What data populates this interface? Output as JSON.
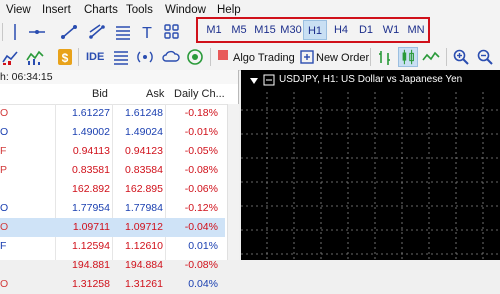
{
  "menubar": {
    "items": [
      {
        "label": "View"
      },
      {
        "label": "Insert"
      },
      {
        "label": "Charts"
      },
      {
        "label": "Tools"
      },
      {
        "label": "Window"
      },
      {
        "label": "Help"
      }
    ]
  },
  "timeframes": {
    "items": [
      {
        "label": "M1",
        "active": false
      },
      {
        "label": "M5",
        "active": false
      },
      {
        "label": "M15",
        "active": false
      },
      {
        "label": "M30",
        "active": false
      },
      {
        "label": "H1",
        "active": true
      },
      {
        "label": "H4",
        "active": false
      },
      {
        "label": "D1",
        "active": false
      },
      {
        "label": "W1",
        "active": false
      },
      {
        "label": "MN",
        "active": false
      }
    ],
    "highlight_color": "#d0101a"
  },
  "toolbar2": {
    "ide_label": "IDE",
    "algo_trading_label": "Algo Trading",
    "new_order_label": "New Order"
  },
  "market_watch": {
    "header": "h: 06:34:15",
    "columns": {
      "bid": "Bid",
      "ask": "Ask",
      "daily_change": "Daily Ch..."
    },
    "rows": [
      {
        "sym": "O",
        "sym_color": "#d23b3b",
        "bid": "1.61227",
        "ask": "1.61248",
        "change": "-0.18%",
        "bid_color": "#1a3fb0",
        "ask_color": "#1a3fb0",
        "change_color": "#d0101a",
        "selected": false
      },
      {
        "sym": "O",
        "sym_color": "#1a3fb0",
        "bid": "1.49002",
        "ask": "1.49024",
        "change": "-0.01%",
        "bid_color": "#1a3fb0",
        "ask_color": "#1a3fb0",
        "change_color": "#d0101a",
        "selected": false
      },
      {
        "sym": "F",
        "sym_color": "#d23b3b",
        "bid": "0.94113",
        "ask": "0.94123",
        "change": "-0.05%",
        "bid_color": "#d0101a",
        "ask_color": "#d0101a",
        "change_color": "#d0101a",
        "selected": false
      },
      {
        "sym": "P",
        "sym_color": "#d23b3b",
        "bid": "0.83581",
        "ask": "0.83584",
        "change": "-0.08%",
        "bid_color": "#d0101a",
        "ask_color": "#d0101a",
        "change_color": "#d0101a",
        "selected": false
      },
      {
        "sym": "",
        "sym_color": "#1a3fb0",
        "bid": "162.892",
        "ask": "162.895",
        "change": "-0.06%",
        "bid_color": "#d0101a",
        "ask_color": "#d0101a",
        "change_color": "#d0101a",
        "selected": false
      },
      {
        "sym": "O",
        "sym_color": "#1a3fb0",
        "bid": "1.77954",
        "ask": "1.77984",
        "change": "-0.12%",
        "bid_color": "#1a3fb0",
        "ask_color": "#1a3fb0",
        "change_color": "#d0101a",
        "selected": false
      },
      {
        "sym": "O",
        "sym_color": "#d23b3b",
        "bid": "1.09711",
        "ask": "1.09712",
        "change": "-0.04%",
        "bid_color": "#d0101a",
        "ask_color": "#d0101a",
        "change_color": "#d0101a",
        "selected": true
      },
      {
        "sym": "F",
        "sym_color": "#1a3fb0",
        "bid": "1.12594",
        "ask": "1.12610",
        "change": "0.01%",
        "bid_color": "#d0101a",
        "ask_color": "#d0101a",
        "change_color": "#1a3fb0",
        "selected": false
      },
      {
        "sym": "",
        "sym_color": "#d23b3b",
        "bid": "194.881",
        "ask": "194.884",
        "change": "-0.08%",
        "bid_color": "#d0101a",
        "ask_color": "#d0101a",
        "change_color": "#d0101a",
        "selected": false
      },
      {
        "sym": "O",
        "sym_color": "#d23b3b",
        "bid": "1.31258",
        "ask": "1.31261",
        "change": "0.04%",
        "bid_color": "#d0101a",
        "ask_color": "#d0101a",
        "change_color": "#1a3fb0",
        "selected": false
      }
    ]
  },
  "chart": {
    "title": "USDJPY, H1:  US Dollar vs Japanese Yen",
    "background": "#000000",
    "grid_color": "#8a8a8a"
  },
  "icons": [
    "cursor-icon",
    "crosshair-icon",
    "trendline-icon",
    "channel-icon",
    "fibonacci-icon",
    "text-icon",
    "shapes-icon",
    "chart-type-icon",
    "indicators-icon",
    "ide-icon",
    "market-icon",
    "signals-icon",
    "cloud-icon",
    "vps-icon",
    "algo-trading-icon",
    "new-order-icon",
    "bar-chart-icon",
    "candlestick-icon",
    "line-chart-icon",
    "zoom-in-icon",
    "zoom-out-icon",
    "tile-windows-icon"
  ]
}
